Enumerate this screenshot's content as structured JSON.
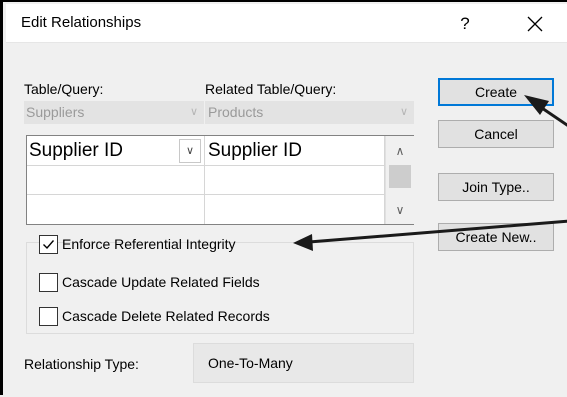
{
  "dialog": {
    "title": "Edit Relationships",
    "help_glyph": "?"
  },
  "table_query": {
    "label": "Table/Query:",
    "value": "Suppliers"
  },
  "related_table_query": {
    "label": "Related Table/Query:",
    "value": "Products"
  },
  "fields_grid": {
    "rows": [
      {
        "left": "Supplier ID",
        "right": "Supplier ID"
      },
      {
        "left": "",
        "right": ""
      },
      {
        "left": "",
        "right": ""
      }
    ]
  },
  "options": {
    "enforce_integrity": {
      "label": "Enforce Referential Integrity",
      "checked": true
    },
    "cascade_update": {
      "label": "Cascade Update Related Fields",
      "checked": false
    },
    "cascade_delete": {
      "label": "Cascade Delete Related Records",
      "checked": false
    }
  },
  "relationship": {
    "label": "Relationship Type:",
    "value": "One-To-Many"
  },
  "buttons": {
    "create": "Create",
    "cancel": "Cancel",
    "join_type": "Join Type..",
    "create_new": "Create New.."
  },
  "colors": {
    "focus_border": "#0078d7",
    "annotation_arrow": "#1a1a1a"
  }
}
